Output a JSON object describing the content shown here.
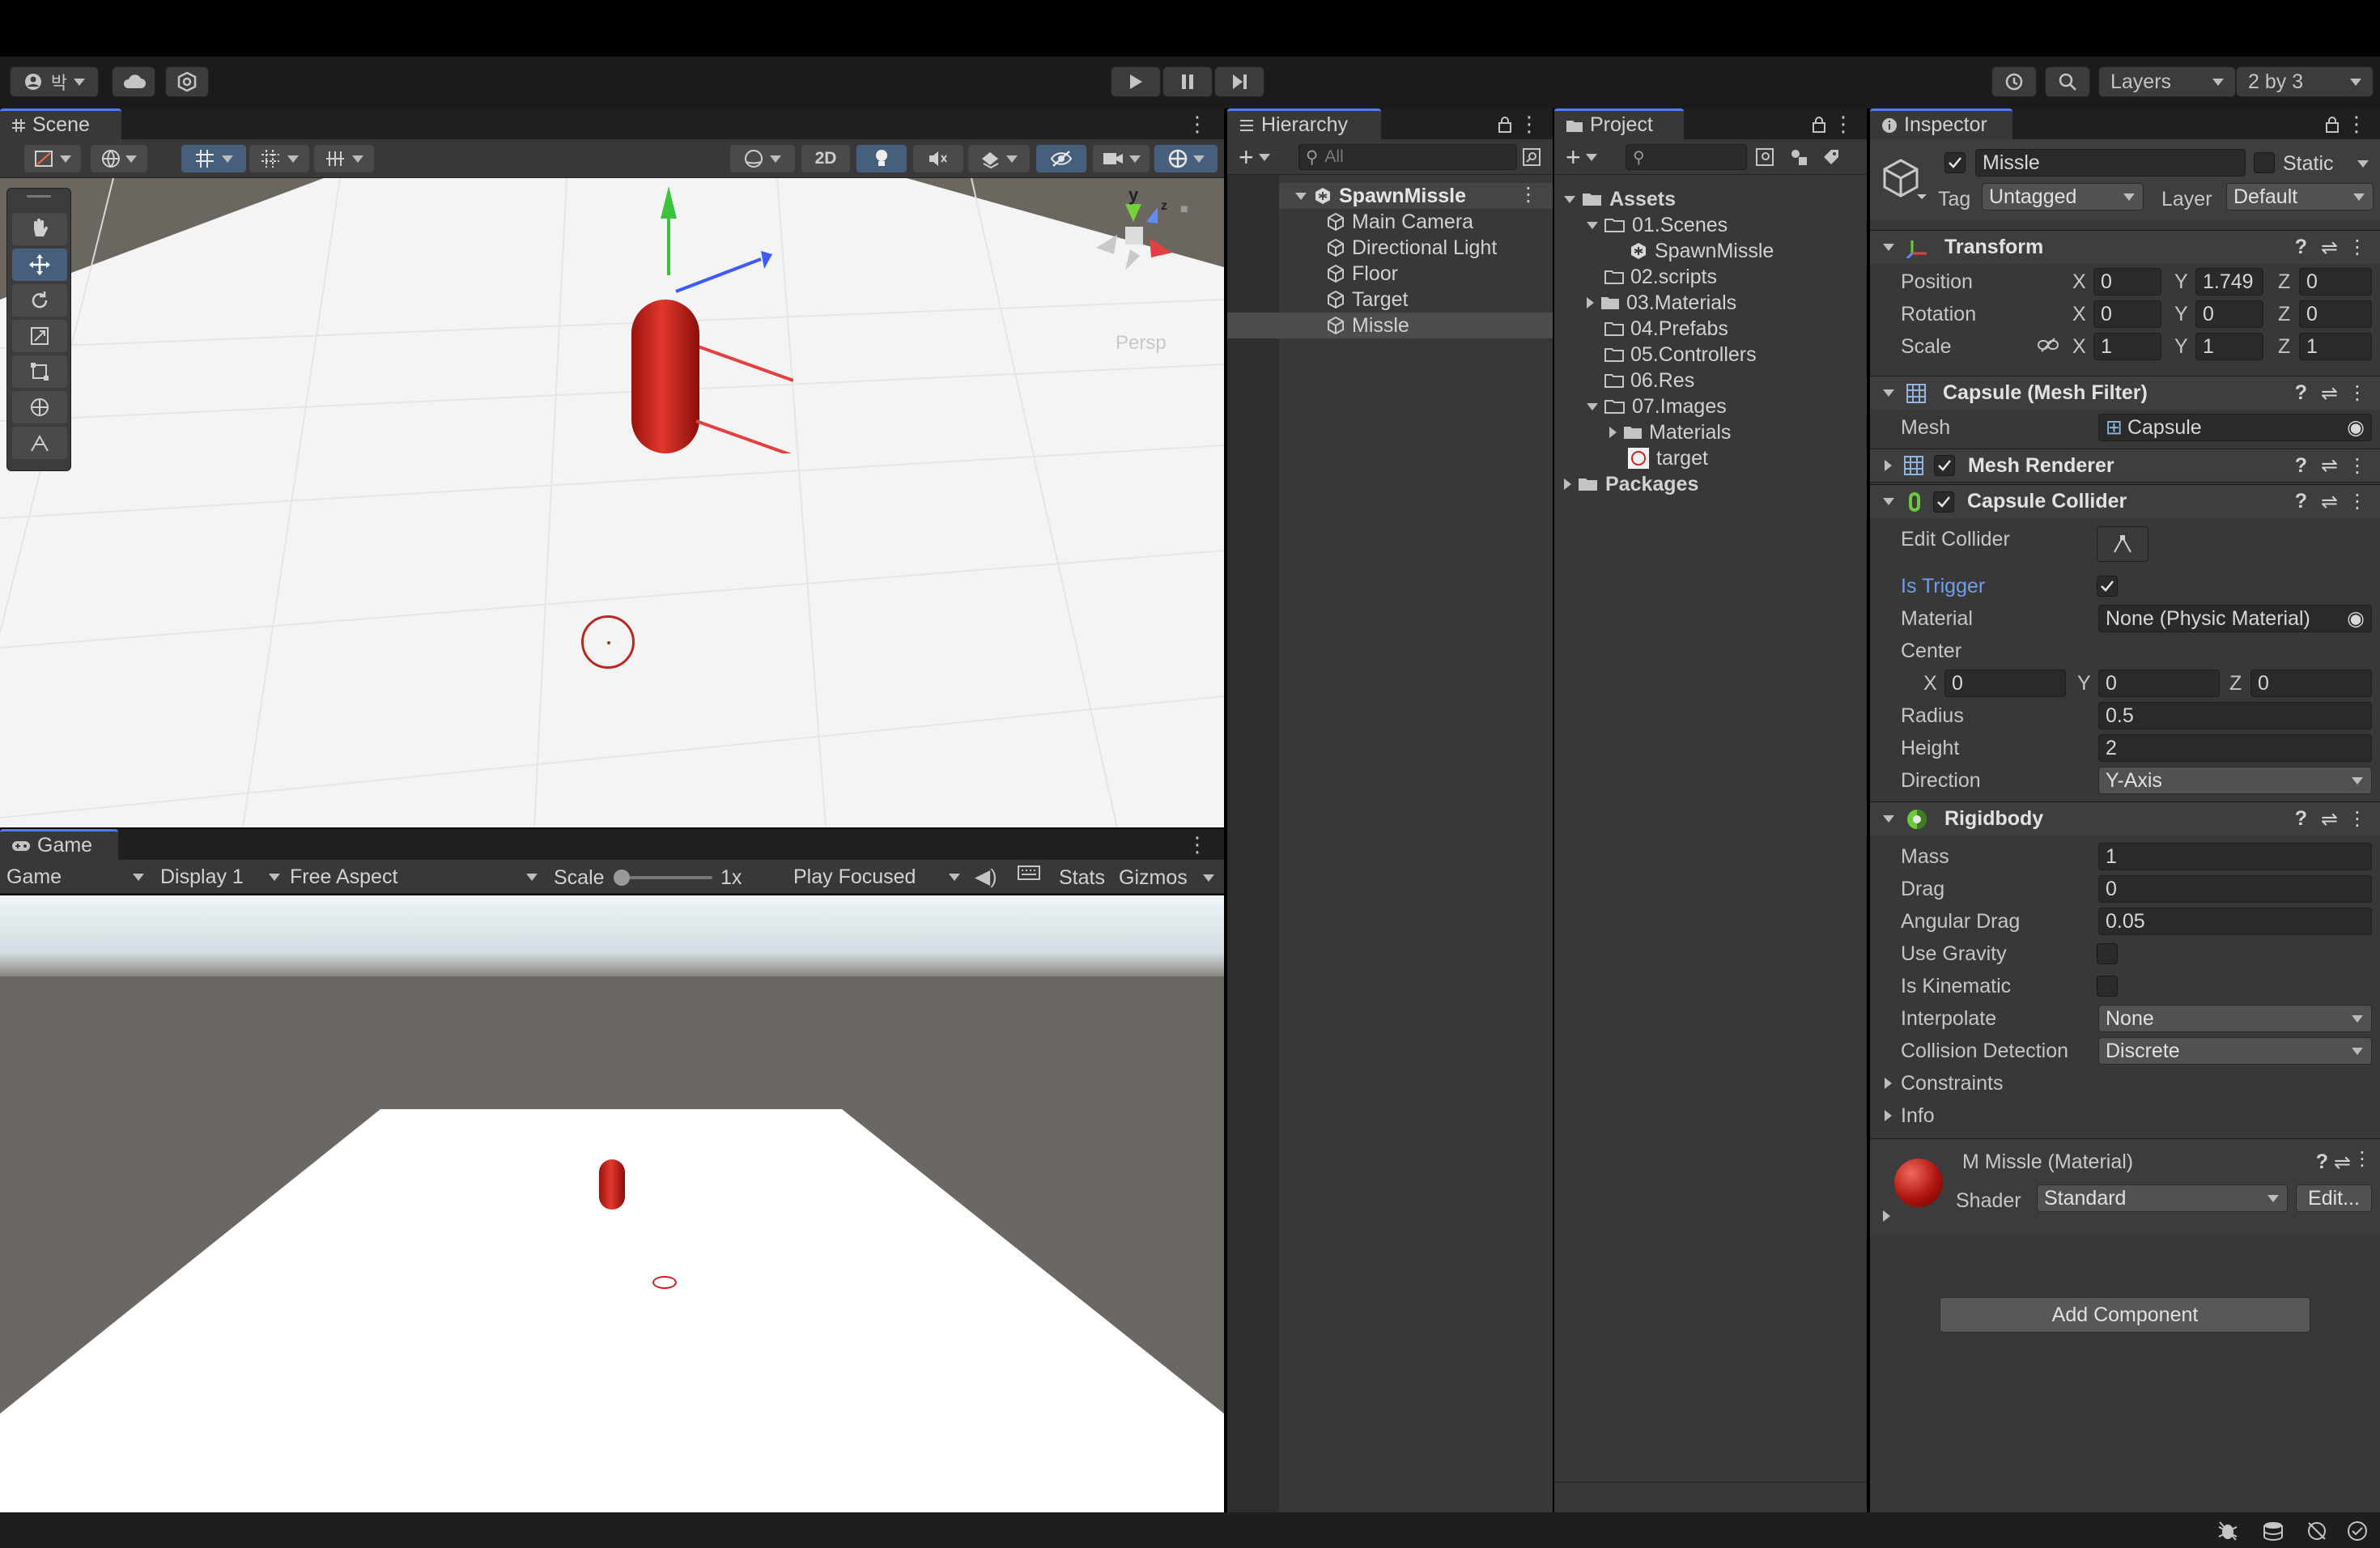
{
  "toolbar": {
    "account_label": "박",
    "layers_label": "Layers",
    "layout_label": "2 by 3"
  },
  "scene": {
    "tab_label": "Scene",
    "mode_2d": "2D",
    "gizmo_axis_y": "y",
    "gizmo_axis_z": "z",
    "persp_label": "Persp"
  },
  "game": {
    "tab_label": "Game",
    "view_dropdown": "Game",
    "display_dropdown": "Display 1",
    "aspect_dropdown": "Free Aspect",
    "scale_label": "Scale",
    "scale_value": "1x",
    "play_mode_dropdown": "Play Focused",
    "stats_label": "Stats",
    "gizmos_label": "Gizmos"
  },
  "hierarchy": {
    "tab_label": "Hierarchy",
    "search_placeholder": "All",
    "scene_name": "SpawnMissle",
    "items": [
      "Main Camera",
      "Directional Light",
      "Floor",
      "Target",
      "Missle"
    ]
  },
  "project": {
    "tab_label": "Project",
    "tree": {
      "assets": "Assets",
      "scenes": "01.Scenes",
      "scene_file": "SpawnMissle",
      "scripts": "02.scripts",
      "materials": "03.Materials",
      "prefabs": "04.Prefabs",
      "controllers": "05.Controllers",
      "res": "06.Res",
      "images": "07.Images",
      "images_materials": "Materials",
      "target": "target",
      "packages": "Packages"
    }
  },
  "inspector": {
    "tab_label": "Inspector",
    "object_name": "Missle",
    "static_label": "Static",
    "tag_label": "Tag",
    "tag_value": "Untagged",
    "layer_label": "Layer",
    "layer_value": "Default",
    "transform": {
      "title": "Transform",
      "position_label": "Position",
      "rotation_label": "Rotation",
      "scale_label": "Scale",
      "axis_x": "X",
      "axis_y": "Y",
      "axis_z": "Z",
      "position": [
        "0",
        "1.749",
        "0"
      ],
      "rotation": [
        "0",
        "0",
        "0"
      ],
      "scale": [
        "1",
        "1",
        "1"
      ]
    },
    "mesh_filter": {
      "title": "Capsule (Mesh Filter)",
      "mesh_label": "Mesh",
      "mesh_value": "Capsule"
    },
    "mesh_renderer": {
      "title": "Mesh Renderer"
    },
    "capsule_collider": {
      "title": "Capsule Collider",
      "edit_collider_label": "Edit Collider",
      "is_trigger_label": "Is Trigger",
      "material_label": "Material",
      "material_value": "None (Physic Material)",
      "center_label": "Center",
      "center": [
        "0",
        "0",
        "0"
      ],
      "radius_label": "Radius",
      "radius_value": "0.5",
      "height_label": "Height",
      "height_value": "2",
      "direction_label": "Direction",
      "direction_value": "Y-Axis"
    },
    "rigidbody": {
      "title": "Rigidbody",
      "mass_label": "Mass",
      "mass_value": "1",
      "drag_label": "Drag",
      "drag_value": "0",
      "angular_drag_label": "Angular Drag",
      "angular_drag_value": "0.05",
      "use_gravity_label": "Use Gravity",
      "is_kinematic_label": "Is Kinematic",
      "interpolate_label": "Interpolate",
      "interpolate_value": "None",
      "collision_label": "Collision Detection",
      "collision_value": "Discrete",
      "constraints_label": "Constraints",
      "info_label": "Info"
    },
    "material": {
      "title": "M Missle (Material)",
      "shader_label": "Shader",
      "shader_value": "Standard",
      "edit_label": "Edit..."
    },
    "add_component_label": "Add Component"
  },
  "colors": {
    "accent": "#4c7fff",
    "panel": "#383838",
    "selection": "#4d4d4d",
    "missile_red": "#c8231d"
  }
}
